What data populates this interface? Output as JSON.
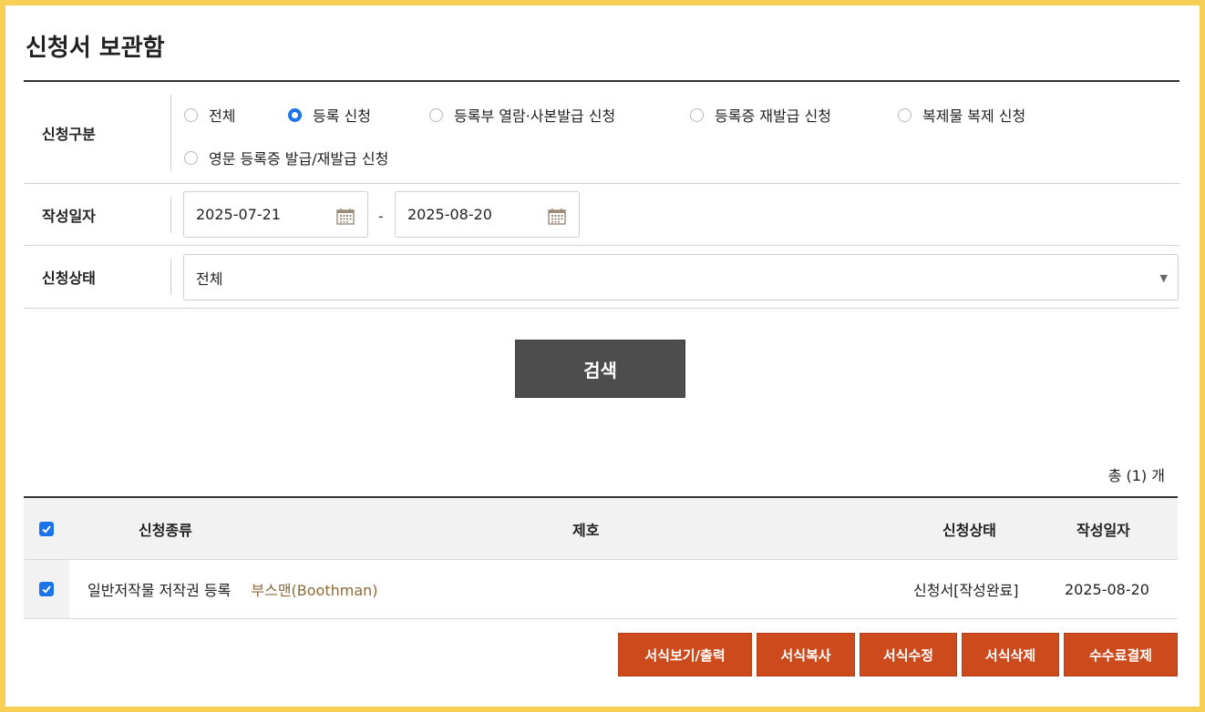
{
  "page": {
    "title": "신청서 보관함"
  },
  "filters": {
    "type_label": "신청구분",
    "type_options": [
      {
        "label": "전체",
        "selected": false
      },
      {
        "label": "등록 신청",
        "selected": true
      },
      {
        "label": "등록부 열람·사본발급 신청",
        "selected": false
      },
      {
        "label": "등록증 재발급 신청",
        "selected": false
      },
      {
        "label": "복제물 복제 신청",
        "selected": false
      },
      {
        "label": "영문 등록증 발급/재발급 신청",
        "selected": false
      }
    ],
    "date_label": "작성일자",
    "date_from": "2025-07-21",
    "date_sep": "-",
    "date_to": "2025-08-20",
    "status_label": "신청상태",
    "status_value": "전체",
    "search_label": "검색"
  },
  "results": {
    "total_text": "총 (1) 개",
    "columns": {
      "kind": "신청종류",
      "title": "제호",
      "status": "신청상태",
      "date": "작성일자"
    },
    "rows": [
      {
        "kind": "일반저작물 저작권 등록",
        "title": "부스맨(Boothman)",
        "status": "신청서[작성완료]",
        "date": "2025-08-20",
        "checked": true
      }
    ]
  },
  "actions": [
    {
      "label": "서식보기/출력"
    },
    {
      "label": "서식복사"
    },
    {
      "label": "서식수정"
    },
    {
      "label": "서식삭제"
    },
    {
      "label": "수수료결제"
    }
  ],
  "colors": {
    "accent": "#cc4a1c",
    "radio": "#1a73e8",
    "frame": "#f7cf55",
    "search_button": "#4d4d4d"
  }
}
